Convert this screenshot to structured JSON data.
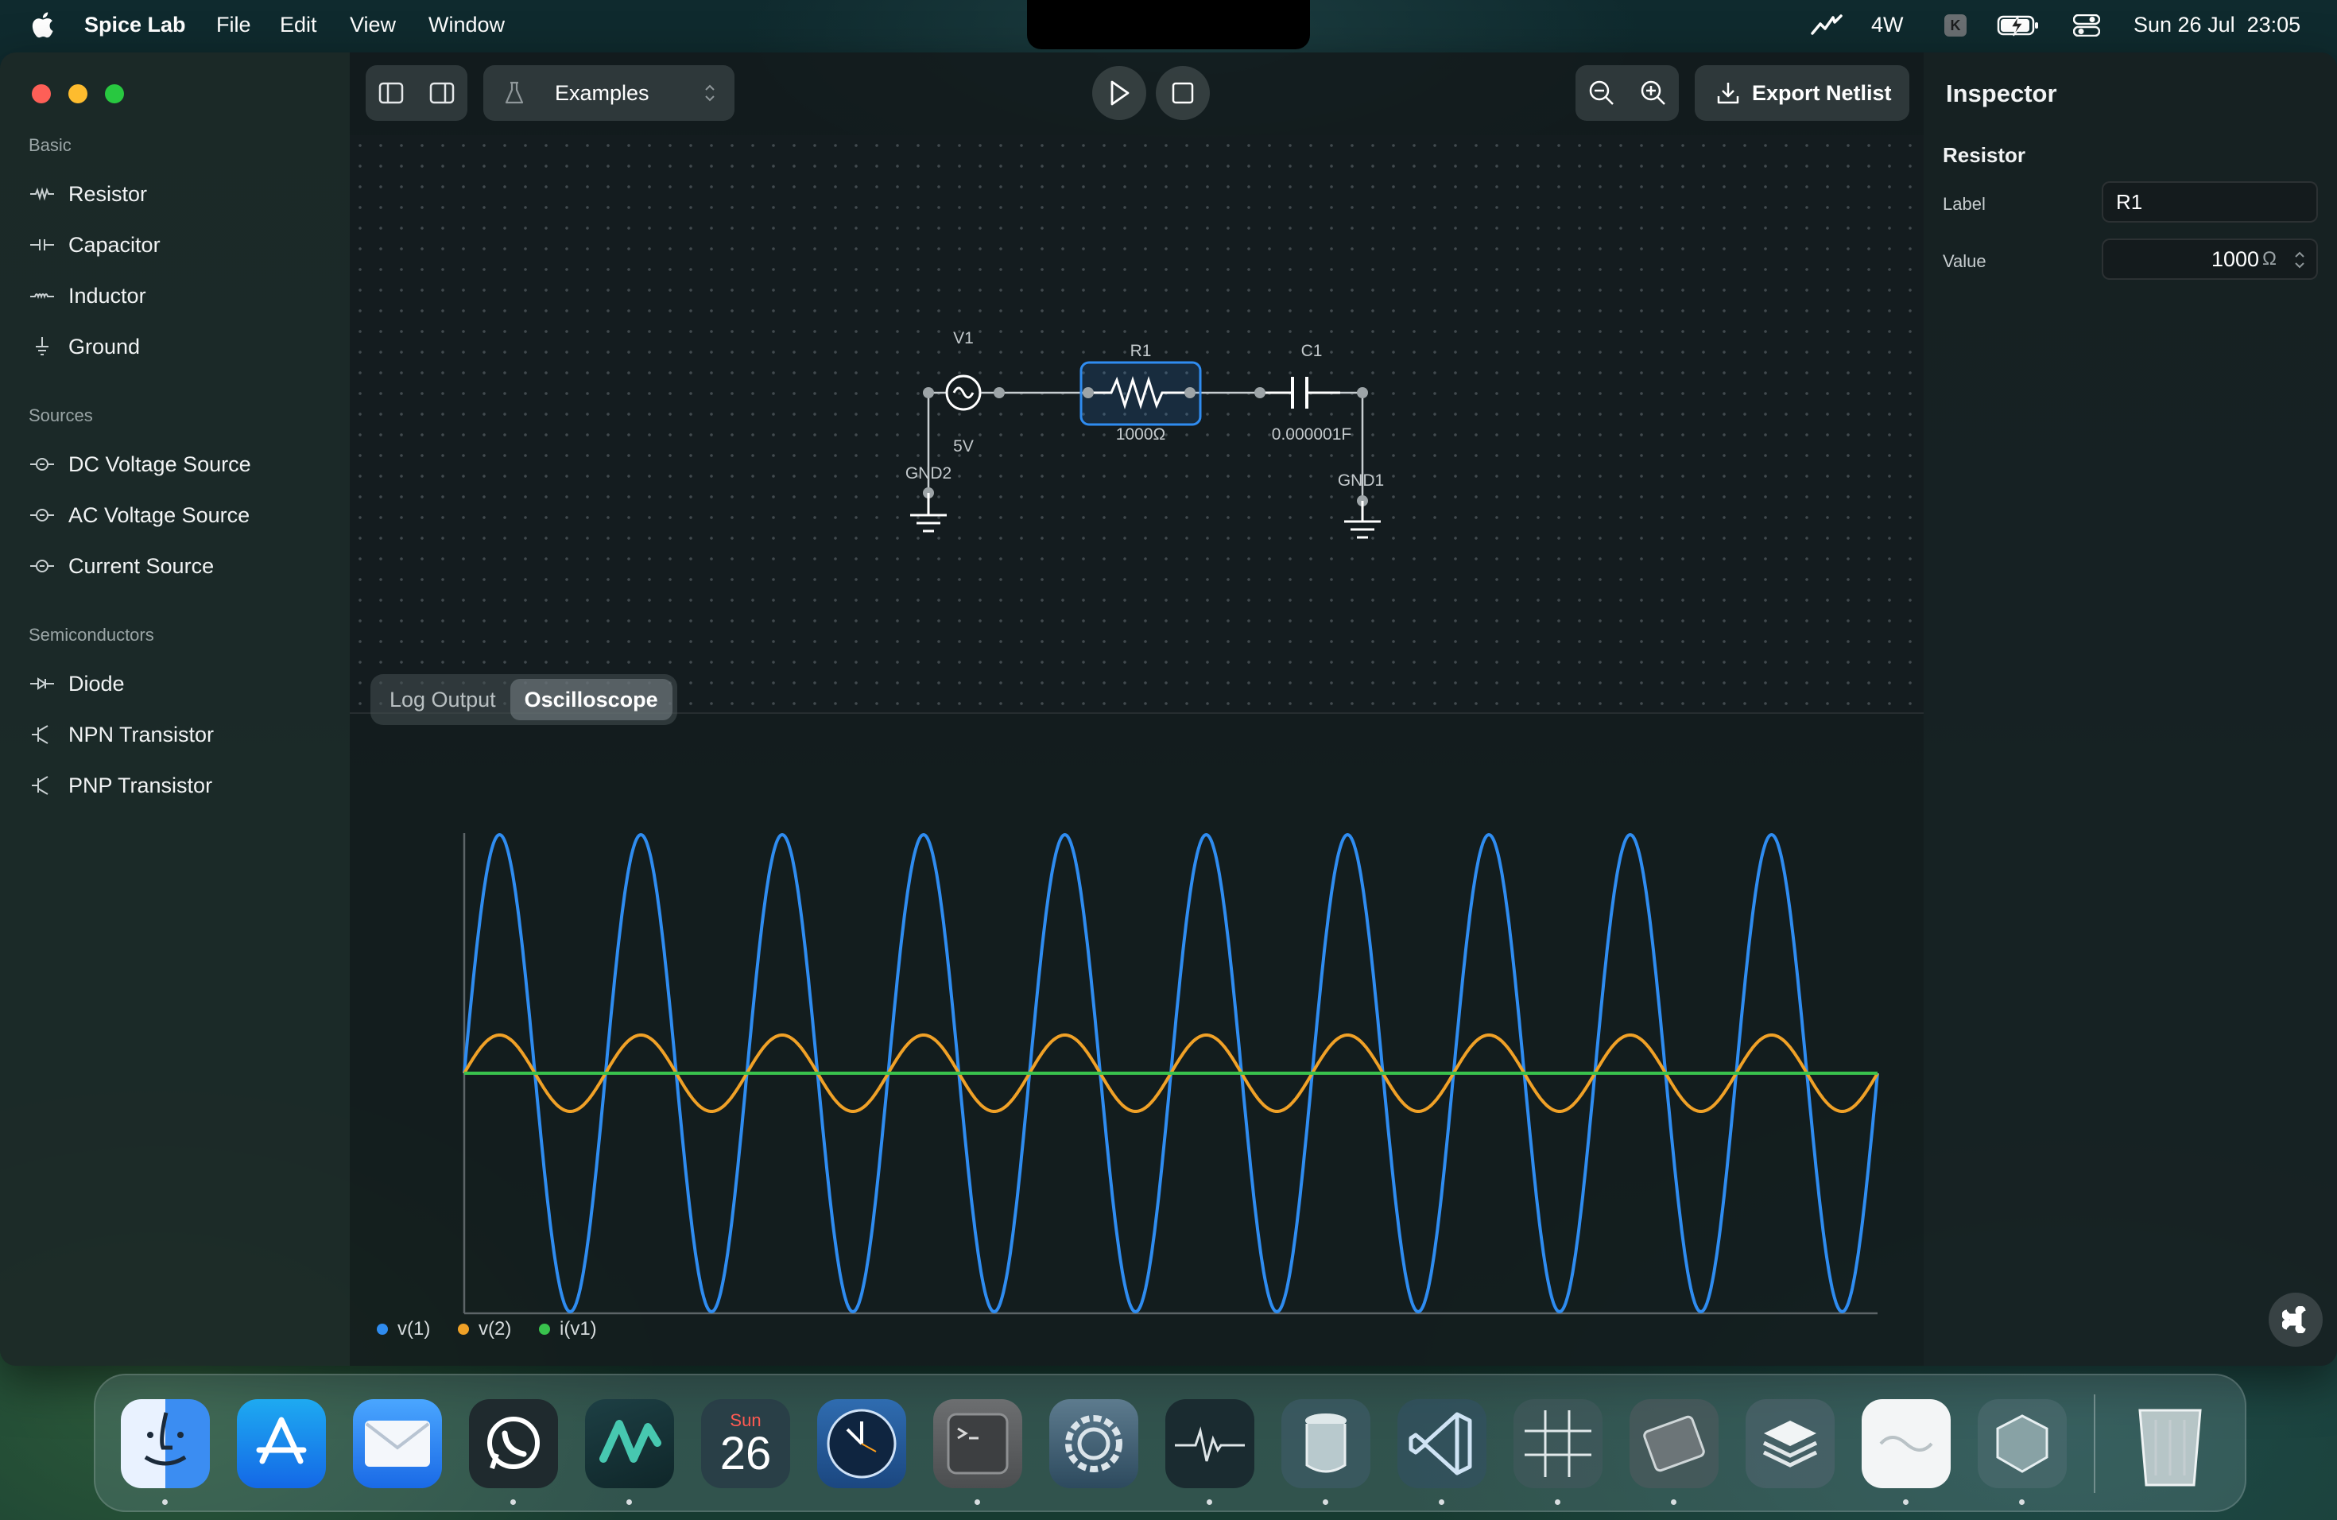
{
  "menubar": {
    "app_name": "Spice Lab",
    "menus": [
      "File",
      "Edit",
      "View",
      "Window"
    ],
    "status_power": "4W",
    "datetime": "Sun 26 Jul  23:05"
  },
  "sidebar": {
    "sections": [
      {
        "title": "Basic",
        "items": [
          {
            "label": "Resistor",
            "icon": "resistor-icon"
          },
          {
            "label": "Capacitor",
            "icon": "capacitor-icon"
          },
          {
            "label": "Inductor",
            "icon": "inductor-icon"
          },
          {
            "label": "Ground",
            "icon": "ground-icon"
          }
        ]
      },
      {
        "title": "Sources",
        "items": [
          {
            "label": "DC Voltage Source",
            "icon": "source-icon"
          },
          {
            "label": "AC Voltage Source",
            "icon": "source-icon"
          },
          {
            "label": "Current Source",
            "icon": "source-icon"
          }
        ]
      },
      {
        "title": "Semiconductors",
        "items": [
          {
            "label": "Diode",
            "icon": "diode-icon"
          },
          {
            "label": "NPN Transistor",
            "icon": "transistor-icon"
          },
          {
            "label": "PNP Transistor",
            "icon": "transistor-icon"
          }
        ]
      }
    ]
  },
  "toolbar": {
    "examples_label": "Examples",
    "export_label": "Export Netlist"
  },
  "circuit": {
    "source": {
      "name": "V1",
      "value": "5V"
    },
    "resistor": {
      "name": "R1",
      "value": "1000Ω",
      "selected": true
    },
    "capacitor": {
      "name": "C1",
      "value": "0.000001F"
    },
    "ground_left": "GND2",
    "ground_right": "GND1"
  },
  "bottom_panel": {
    "tabs": [
      {
        "label": "Log Output",
        "active": false
      },
      {
        "label": "Oscilloscope",
        "active": true
      }
    ]
  },
  "chart_data": {
    "type": "line",
    "series": [
      {
        "name": "v(1)",
        "color": "#2f8cf0",
        "shape": "sine",
        "offset": 0,
        "amplitude": 5,
        "cycles": 10
      },
      {
        "name": "v(2)",
        "color": "#f0a127",
        "shape": "sine",
        "offset": 0,
        "amplitude": 0.8,
        "cycles": 10
      },
      {
        "name": "i(v1)",
        "color": "#39c24d",
        "shape": "flat",
        "offset": 0,
        "amplitude": 0,
        "cycles": 0
      }
    ],
    "grid": false,
    "legend_position": "bottom-left"
  },
  "inspector": {
    "title": "Inspector",
    "component_type": "Resistor",
    "label_caption": "Label",
    "label_value": "R1",
    "value_caption": "Value",
    "value_number": "1000",
    "value_unit": "Ω"
  },
  "dock": {
    "calendar_day_name": "Sun",
    "calendar_day_number": "26",
    "apps": [
      "Finder",
      "App Store",
      "Mail",
      "WhatsApp",
      "Spice Lab",
      "Calendar",
      "Clock",
      "Preview",
      "System Settings",
      "Activity Monitor",
      "Container",
      "Visual Studio Code",
      "Numbers",
      "Circuit Tool",
      "Layers",
      "Preview 2",
      "Virtual Machine",
      "Trash"
    ]
  }
}
